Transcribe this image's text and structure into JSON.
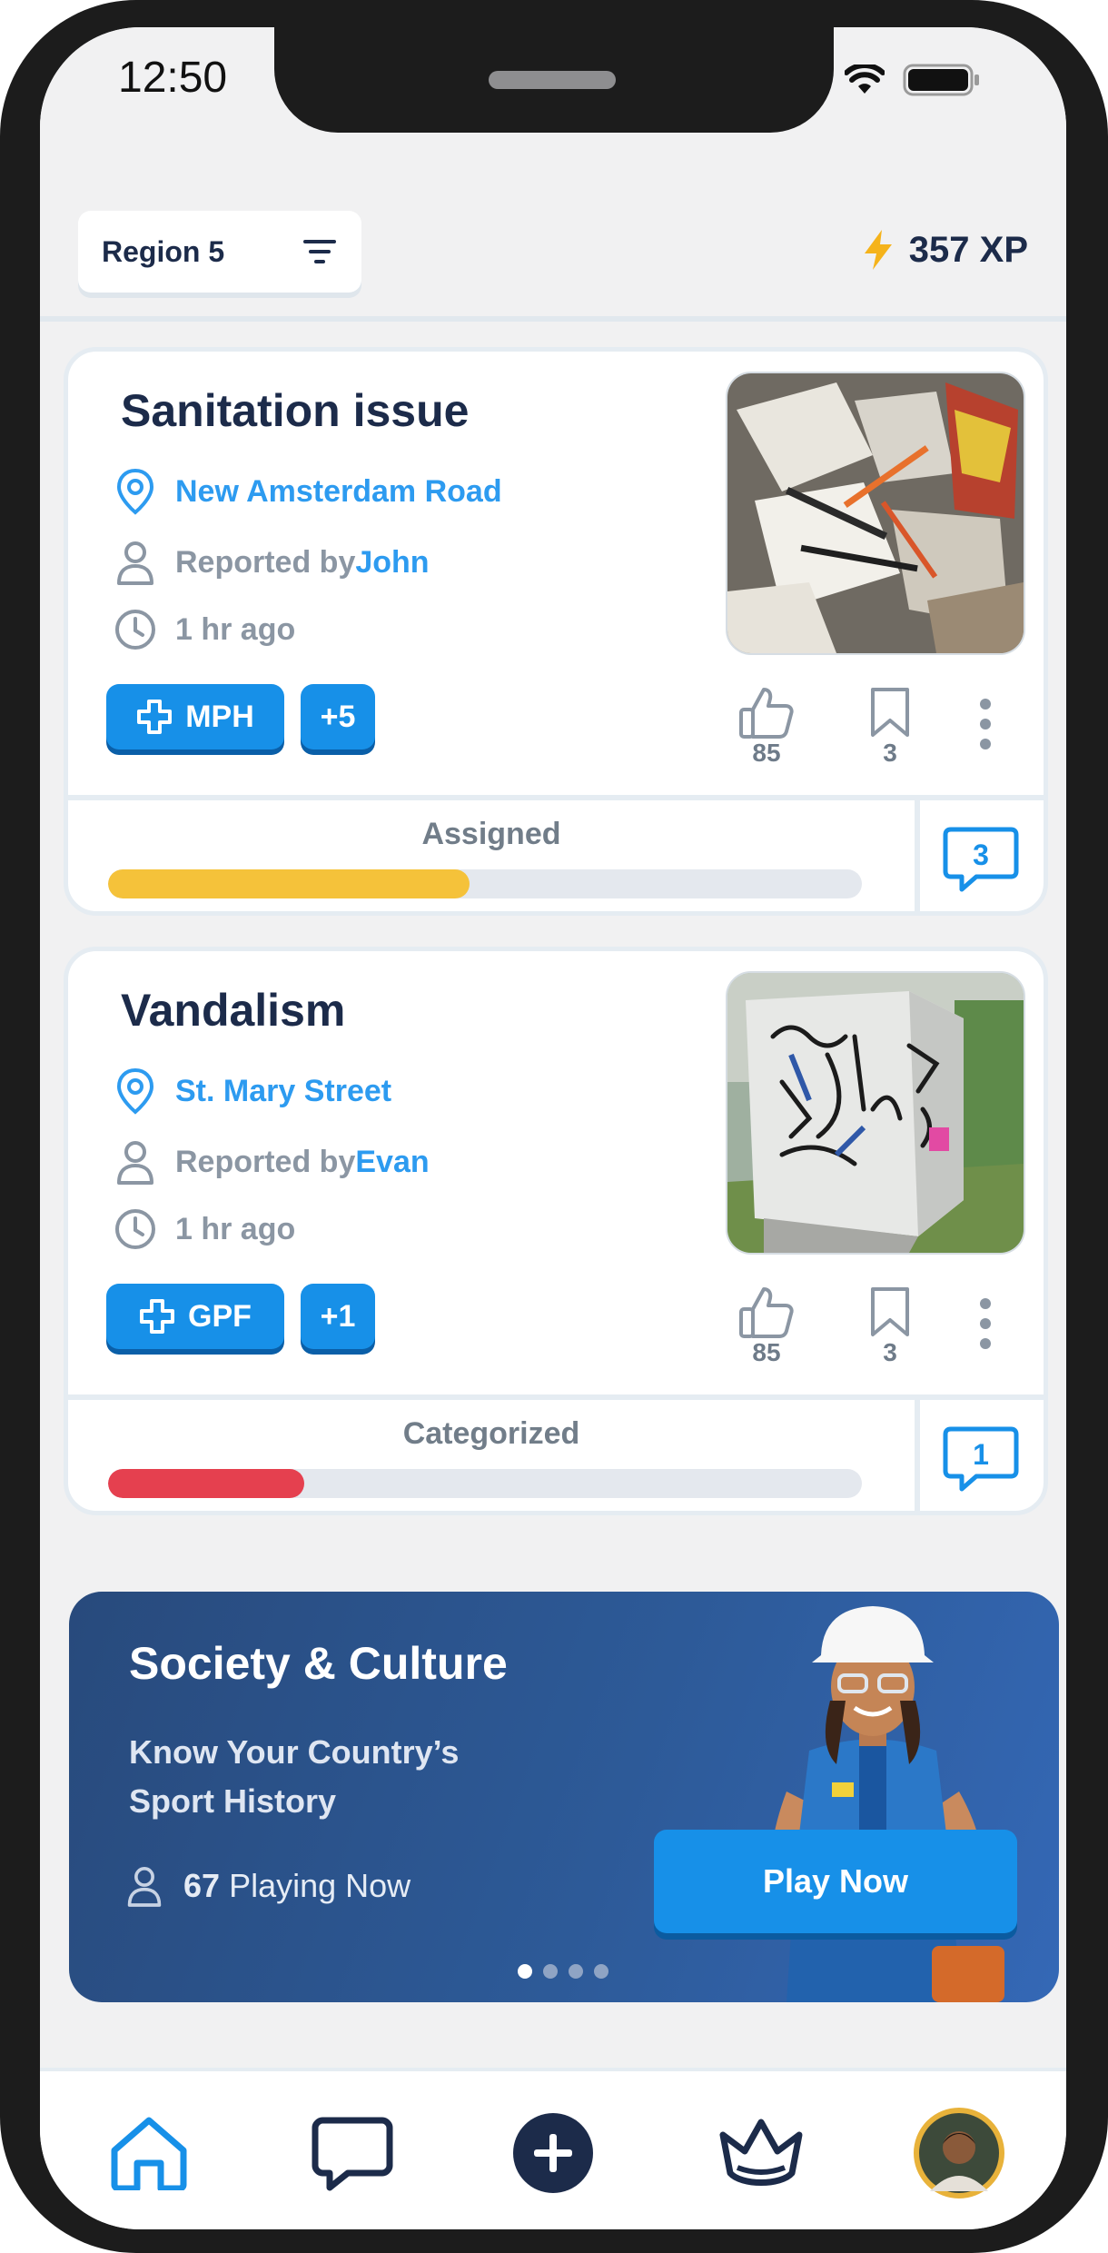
{
  "status_bar": {
    "time": "12:50"
  },
  "header": {
    "region_label": "Region 5",
    "xp_label": "357 XP"
  },
  "reports": [
    {
      "title": "Sanitation issue",
      "location": "New Amsterdam Road",
      "reported_prefix": "Reported by ",
      "reporter": "John",
      "time_ago": "1 hr ago",
      "tag": "MPH",
      "extra_tags": "+5",
      "likes": "85",
      "saves": "3",
      "status": "Assigned",
      "progress": 0.48,
      "progress_color": "#f5c23a",
      "comments": "3"
    },
    {
      "title": "Vandalism",
      "location": "St. Mary Street",
      "reported_prefix": "Reported by ",
      "reporter": "Evan",
      "time_ago": "1 hr ago",
      "tag": "GPF",
      "extra_tags": "+1",
      "likes": "85",
      "saves": "3",
      "status": "Categorized",
      "progress": 0.26,
      "progress_color": "#e5404f",
      "comments": "1"
    }
  ],
  "promo": {
    "title": "Society & Culture",
    "subtitle": "Know Your Country’s Sport History",
    "players_count": "67",
    "players_suffix": "Playing Now",
    "button_label": "Play Now",
    "page_total": 4,
    "page_active": 1
  },
  "nav": {
    "items": [
      "home-icon",
      "chat-icon",
      "add-icon",
      "crown-icon",
      "profile-avatar"
    ],
    "active": "home-icon"
  },
  "colors": {
    "primary": "#1790e8",
    "navy": "#1c2b4a",
    "link": "#2d9bf0",
    "muted": "#8b96a3"
  }
}
